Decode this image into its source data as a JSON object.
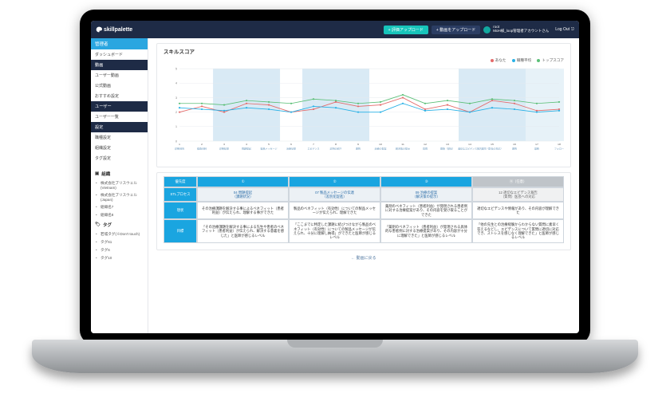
{
  "header": {
    "brand": "skillpalette",
    "btn_primary": "+ 評価アップロード",
    "btn_secondary": "+ 動画をアップロード",
    "user_line1": "root",
    "user_line2": "MoH様_loop管理者アカウントさん",
    "logout": "Log Out"
  },
  "sidebar": {
    "role": "管理者",
    "groups": [
      {
        "label": "ダッシュボード",
        "type": "item"
      },
      {
        "label": "動画",
        "type": "head"
      },
      {
        "label": "ユーザー動画",
        "type": "item"
      },
      {
        "label": "公式動画",
        "type": "item"
      },
      {
        "label": "おすすめ設定",
        "type": "item"
      },
      {
        "label": "ユーザー",
        "type": "head"
      },
      {
        "label": "ユーザー一覧",
        "type": "item"
      },
      {
        "label": "設定",
        "type": "head"
      },
      {
        "label": "職種設定",
        "type": "item"
      },
      {
        "label": "組織設定",
        "type": "item"
      },
      {
        "label": "タグ設定",
        "type": "item"
      }
    ],
    "org_title": "組織",
    "orgs": [
      "株式会社ブリスウェル (Vietnam)",
      "株式会社ブリスウェル (Japan)",
      "組織名7",
      "組織名8"
    ],
    "tag_title": "タグ",
    "tags": [
      "若城タグ(※Don't touch)",
      "タグ61",
      "タグ6",
      "タグ10"
    ]
  },
  "panel": {
    "title": "スキルスコア",
    "legend": {
      "you": "あなた",
      "avg": "職種平均",
      "top": "トップスコア"
    },
    "back_link": "← 動画に戻る"
  },
  "chart_data": {
    "type": "line",
    "title": "スキルスコア",
    "xlabel": "",
    "ylabel": "",
    "ylim": [
      0,
      5
    ],
    "categories": [
      "1",
      "2",
      "3",
      "4",
      "5",
      "6",
      "7",
      "8",
      "9",
      "10",
      "11",
      "12",
      "13",
      "14",
      "15",
      "16",
      "17",
      "18"
    ],
    "x_sub_labels": [
      "診断目的",
      "検査材料",
      "診断結果",
      "問題提起",
      "製品メッセージ",
      "治療効果",
      "エビデンス",
      "症例の紹介",
      "要約",
      "治療の提案",
      "解決策の提示",
      "質問",
      "開始（部長）",
      "適切なエビデンス報告",
      "質問（医長の対応）",
      "要約",
      "最終",
      "フォロー"
    ],
    "highlight_bands": [
      [
        3,
        5
      ],
      [
        7,
        9
      ],
      [
        14,
        16
      ],
      [
        17,
        18
      ]
    ],
    "series": [
      {
        "name": "あなた",
        "color": "#e46a6a",
        "values": [
          2.0,
          2.4,
          2.0,
          2.6,
          2.5,
          2.0,
          2.2,
          2.7,
          2.4,
          2.5,
          3.0,
          2.2,
          2.5,
          2.0,
          2.8,
          2.6,
          2.1,
          2.2
        ]
      },
      {
        "name": "職種平均",
        "color": "#29b1e6",
        "values": [
          2.3,
          2.2,
          2.1,
          2.3,
          2.2,
          2.0,
          2.4,
          2.3,
          2.0,
          2.0,
          2.6,
          2.1,
          2.2,
          2.0,
          2.3,
          2.2,
          2.0,
          2.1
        ]
      },
      {
        "name": "トップスコア",
        "color": "#5bbf77",
        "values": [
          2.6,
          2.6,
          2.5,
          2.8,
          2.7,
          2.6,
          2.9,
          2.8,
          2.6,
          2.7,
          3.2,
          2.6,
          2.8,
          2.6,
          2.9,
          2.8,
          2.6,
          2.7
        ]
      }
    ]
  },
  "table": {
    "row_heads": [
      "優先度",
      "STLプロセス",
      "現状",
      "目標"
    ],
    "cols": [
      {
        "priority": "①",
        "process_code": "04 問題提起",
        "process_sub": "（課題状況）",
        "current": "その治療課題を解決する事によるベネフィット（患者利益）が伝えられ、理解する事ができた",
        "target": "「その治療課題を解決する事による先生や患者のベネフィット（患者利益）が伝えられ、解決する意義を感じた」と医師が感じるレベル"
      },
      {
        "priority": "②",
        "process_code": "07 製品メッセージの伝達",
        "process_sub": "（差別化促進）",
        "current": "製品のベネフィット（有効性）についての製品メッセージが伝えられ、理解できた",
        "target": "「ここまでに特定した課題に結びつけながら製品のベネフィット（有効性）についての製品メッセージが伝えられ、十分に理解し納得」ができたと医師が感じるレベル"
      },
      {
        "priority": "③",
        "process_code": "09 治療の提案",
        "process_sub": "（解決策の提示）",
        "current": "薬剤のベネフィット（患者利益）が発現される患者例に対する治療提案があり、その内容を受け取ることができた",
        "target": "「薬剤のベネフィット（患者利益）が発現される具体的な患者例に対する治療提案があり、その内容が十分に理解できた」と医師が感じるレベル"
      },
      {
        "priority": "④（任意）",
        "process_code": "12 適切なエビデンス報告",
        "process_sub": "（質問）医長への対応",
        "current": "適切なエビデンスや情報があり、その内容が理解できた",
        "target": "「他の先生との治療経験からわからない質問に素早く答えるなどし、エビデンスについて質問に適切に対応でき、ストレスを感じなく理解できた」と医師が感じるレベル",
        "dim": true
      }
    ]
  }
}
